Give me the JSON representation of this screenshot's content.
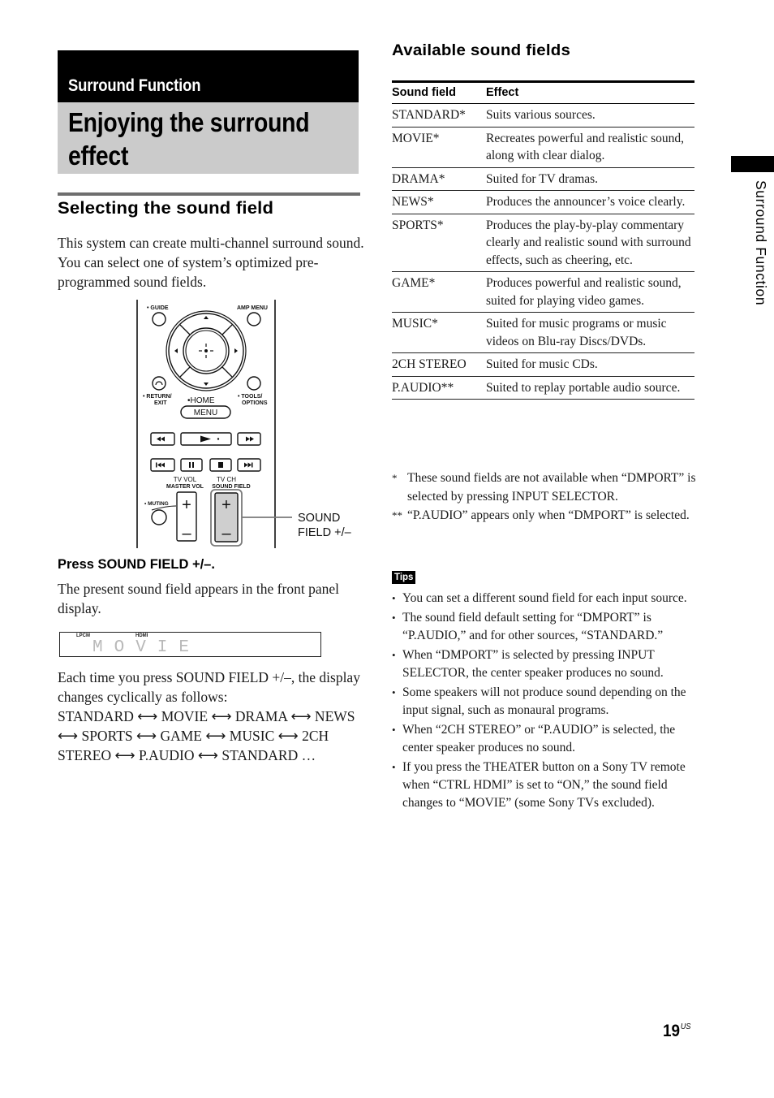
{
  "section": {
    "banner": "Surround Function",
    "title": "Enjoying the surround effect"
  },
  "left": {
    "heading": "Selecting the sound field",
    "intro": "This system can create multi-channel surround sound. You can select one of system’s optimized pre-programmed sound fields.",
    "remote": {
      "guide": "GUIDE",
      "amp_menu": "AMP MENU",
      "return_exit_1": "RETURN/",
      "return_exit_2": "EXIT",
      "home": "HOME",
      "menu": "MENU",
      "tools_1": "TOOLS/",
      "tools_2": "OPTIONS",
      "tv_vol": "TV VOL",
      "master_vol": "MASTER VOL",
      "tv_ch": "TV CH",
      "sound_field": "SOUND FIELD",
      "muting": "MUTING",
      "plus": "+",
      "minus": "–",
      "callout_1": "SOUND",
      "callout_2": "FIELD +/–"
    },
    "step": "Press SOUND FIELD +/–.",
    "step_desc": "The present sound field appears in the front panel display.",
    "display": {
      "lpcm": "LPCM",
      "hdmi": "HDMI",
      "text": "MOVIE"
    },
    "cycle_intro": "Each time you press SOUND FIELD +/–, the display changes cyclically as follows:",
    "cycle": "STANDARD ⟷ MOVIE ⟷ DRAMA ⟷ NEWS ⟷ SPORTS ⟷ GAME ⟷ MUSIC ⟷ 2CH STEREO ⟷ P.AUDIO ⟷ STANDARD …"
  },
  "right": {
    "heading": "Available sound fields",
    "table": {
      "headers": [
        "Sound field",
        "Effect"
      ],
      "rows": [
        [
          "STANDARD*",
          "Suits various sources."
        ],
        [
          "MOVIE*",
          "Recreates powerful and realistic sound, along with clear dialog."
        ],
        [
          "DRAMA*",
          "Suited for TV dramas."
        ],
        [
          "NEWS*",
          "Produces the announcer’s voice clearly."
        ],
        [
          "SPORTS*",
          "Produces the play-by-play commentary clearly and realistic sound with surround effects, such as cheering, etc."
        ],
        [
          "GAME*",
          "Produces powerful and realistic sound, suited for playing video games."
        ],
        [
          "MUSIC*",
          "Suited for music programs or music videos on Blu-ray Discs/DVDs."
        ],
        [
          "2CH STEREO",
          "Suited for music CDs."
        ],
        [
          "P.AUDIO**",
          "Suited to replay portable audio source."
        ]
      ]
    },
    "footnotes": [
      {
        "mark": "*",
        "text": "These sound fields are not available when “DMPORT” is selected by pressing INPUT SELECTOR."
      },
      {
        "mark": "**",
        "text": "“P.AUDIO” appears only when “DMPORT” is selected."
      }
    ],
    "tips_label": "Tips",
    "tips": [
      "You can set a different sound field for each input source.",
      "The sound field default setting for “DMPORT” is “P.AUDIO,” and for other sources, “STANDARD.”",
      "When “DMPORT” is selected by pressing INPUT SELECTOR, the center speaker produces no sound.",
      "Some speakers will not produce sound depending on the input signal, such as monaural programs.",
      "When “2CH STEREO” or “P.AUDIO” is selected, the center speaker produces no sound.",
      "If you press the THEATER button on a Sony TV remote when “CTRL HDMI” is set to “ON,” the sound field changes to “MOVIE” (some Sony TVs excluded)."
    ]
  },
  "side_tab": "Surround Function",
  "page": {
    "number": "19",
    "suffix": "US"
  }
}
